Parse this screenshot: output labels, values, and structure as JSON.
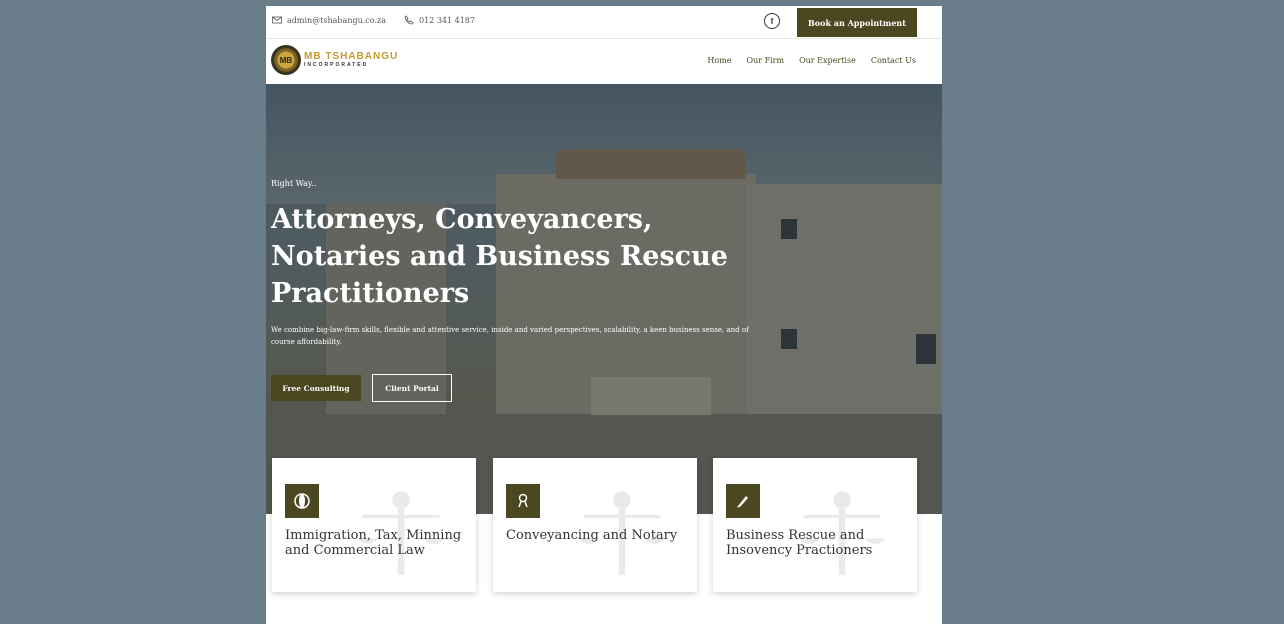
{
  "topbar": {
    "email": "admin@tshabangu.co.za",
    "phone": "012 341 4187",
    "facebook_icon": "f",
    "book_button": "Book an Appointment"
  },
  "logo": {
    "initials": "MB",
    "name": "MB TSHABANGU",
    "subtitle": "INCORPORATED"
  },
  "nav": {
    "items": [
      "Home",
      "Our Firm",
      "Our Expertise",
      "Contact Us"
    ]
  },
  "hero": {
    "eyebrow": "Right Way..",
    "title": "Attorneys, Conveyancers, Notaries and Business Rescue Practitioners",
    "description": "We combine big-law-firm skills, flexible and attentive service, inside and varied perspectives, scalability, a keen business sense, and of course affordability.",
    "primary_button": "Free Consulting",
    "secondary_button": "Client Portal"
  },
  "cards": [
    {
      "title": "Immigration, Tax, Minning and Commercial Law",
      "icon": "globe-icon"
    },
    {
      "title": "Conveyancing and Notary",
      "icon": "user-award-icon"
    },
    {
      "title": "Business Rescue and Insovency Practioners",
      "icon": "pen-icon"
    }
  ],
  "colors": {
    "accent": "#4b4720",
    "background": "#687c89",
    "gold": "#c79a2c"
  }
}
